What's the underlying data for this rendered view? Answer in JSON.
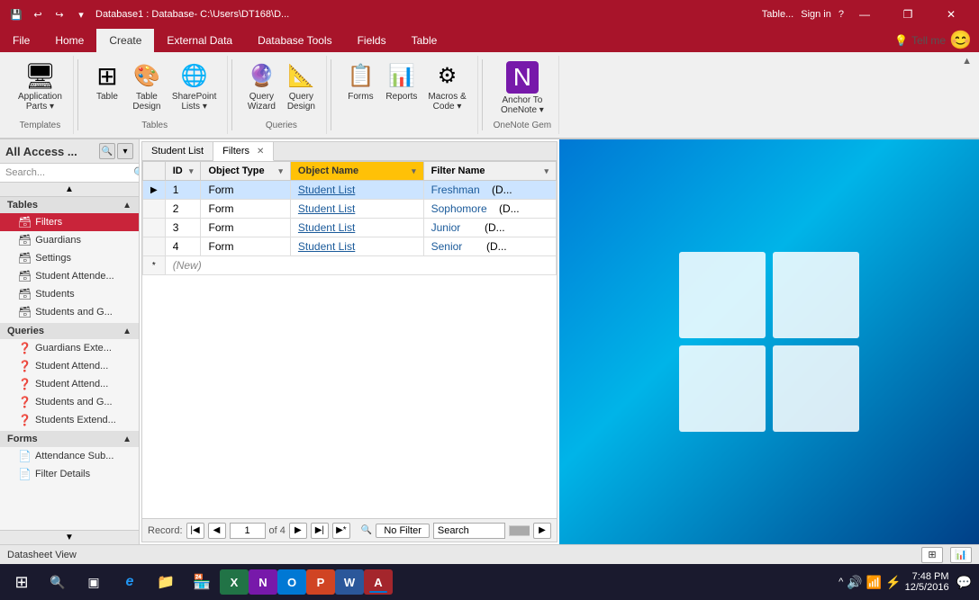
{
  "titleBar": {
    "title": "Database1 : Database- C:\\Users\\DT168\\D...",
    "tableTab": "Table...",
    "signIn": "Sign in",
    "help": "?",
    "quickAccess": [
      "save",
      "undo",
      "redo",
      "dropdown"
    ]
  },
  "ribbon": {
    "tabs": [
      "File",
      "Home",
      "Create",
      "External Data",
      "Database Tools",
      "Fields",
      "Table"
    ],
    "activeTab": "Create",
    "tellMe": "Tell me",
    "groups": [
      {
        "label": "Templates",
        "items": [
          {
            "icon": "🖥",
            "label": "Application\nParts ▾"
          }
        ]
      },
      {
        "label": "Tables",
        "items": [
          {
            "icon": "⊞",
            "label": "Table"
          },
          {
            "icon": "🎨",
            "label": "Table\nDesign"
          },
          {
            "icon": "🌐",
            "label": "SharePoint\nLists ▾"
          }
        ]
      },
      {
        "label": "Queries",
        "items": [
          {
            "icon": "🔮",
            "label": "Query\nWizard"
          },
          {
            "icon": "📐",
            "label": "Query\nDesign"
          }
        ]
      },
      {
        "label": "",
        "items": [
          {
            "icon": "📋",
            "label": "Forms"
          },
          {
            "icon": "📊",
            "label": "Reports"
          },
          {
            "icon": "⚙",
            "label": "Macros &\nCode ▾"
          }
        ]
      },
      {
        "label": "OneNote Gem",
        "items": [
          {
            "icon": "N",
            "label": "Anchor To\nOneNote ▾"
          }
        ]
      }
    ]
  },
  "navPanel": {
    "title": "All Access ...",
    "searchPlaceholder": "Search...",
    "sections": [
      {
        "label": "Tables",
        "expanded": true,
        "items": [
          {
            "icon": "🗃",
            "label": "Filters",
            "active": true
          },
          {
            "icon": "🗃",
            "label": "Guardians"
          },
          {
            "icon": "🗃",
            "label": "Settings"
          },
          {
            "icon": "🗃",
            "label": "Student Attende..."
          },
          {
            "icon": "🗃",
            "label": "Students"
          },
          {
            "icon": "🗃",
            "label": "Students and G..."
          }
        ]
      },
      {
        "label": "Queries",
        "expanded": true,
        "items": [
          {
            "icon": "❓",
            "label": "Guardians Exte..."
          },
          {
            "icon": "❓",
            "label": "Student Attend..."
          },
          {
            "icon": "❓",
            "label": "Student Attend..."
          },
          {
            "icon": "❓",
            "label": "Students and G..."
          },
          {
            "icon": "❓",
            "label": "Students Extend..."
          }
        ]
      },
      {
        "label": "Forms",
        "expanded": true,
        "items": [
          {
            "icon": "📄",
            "label": "Attendance Sub..."
          },
          {
            "icon": "📄",
            "label": "Filter Details"
          }
        ]
      }
    ]
  },
  "tableWindow": {
    "tabs": [
      {
        "label": "Student List",
        "active": false
      },
      {
        "label": "Filters",
        "active": true
      }
    ],
    "columns": [
      {
        "label": "ID",
        "width": 40
      },
      {
        "label": "Object Type",
        "width": 90
      },
      {
        "label": "Object Name",
        "width": 140
      },
      {
        "label": "Filter Name",
        "width": 140
      }
    ],
    "rows": [
      {
        "selector": "▶",
        "id": "1",
        "objectType": "Form",
        "objectName": "Student List",
        "filterName": "Freshman",
        "filterNameFull": "(D...",
        "selected": true
      },
      {
        "selector": "",
        "id": "2",
        "objectType": "Form",
        "objectName": "Student List",
        "filterName": "Sophomore",
        "filterNameFull": "(D...",
        "selected": false
      },
      {
        "selector": "",
        "id": "3",
        "objectType": "Form",
        "objectName": "Student List",
        "filterName": "Junior",
        "filterNameFull": "(D...",
        "selected": false
      },
      {
        "selector": "",
        "id": "4",
        "objectType": "Form",
        "objectName": "Student List",
        "filterName": "Senior",
        "filterNameFull": "(D...",
        "selected": false
      }
    ],
    "newRow": "(New)",
    "recordNav": {
      "label": "Record:",
      "current": "1",
      "total": "of 4",
      "filterStatus": "No Filter",
      "searchPlaceholder": "Search"
    }
  },
  "statusBar": {
    "text": "Datasheet View",
    "viewIcons": [
      "grid",
      "layout"
    ]
  },
  "taskbar": {
    "time": "7:48 PM",
    "date": "12/5/2016",
    "apps": [
      {
        "icon": "⊞",
        "name": "start"
      },
      {
        "icon": "🔍",
        "name": "search"
      },
      {
        "icon": "▣",
        "name": "task-view"
      },
      {
        "icon": "e",
        "name": "edge"
      },
      {
        "icon": "📁",
        "name": "explorer"
      },
      {
        "icon": "🏪",
        "name": "store"
      },
      {
        "icon": "📗",
        "name": "excel"
      },
      {
        "icon": "N",
        "name": "onenote"
      },
      {
        "icon": "O",
        "name": "outlook"
      },
      {
        "icon": "P",
        "name": "powerpoint"
      },
      {
        "icon": "W",
        "name": "word"
      },
      {
        "icon": "A",
        "name": "access"
      }
    ],
    "systray": [
      "^",
      "🔊",
      "📶",
      "⚡"
    ]
  }
}
